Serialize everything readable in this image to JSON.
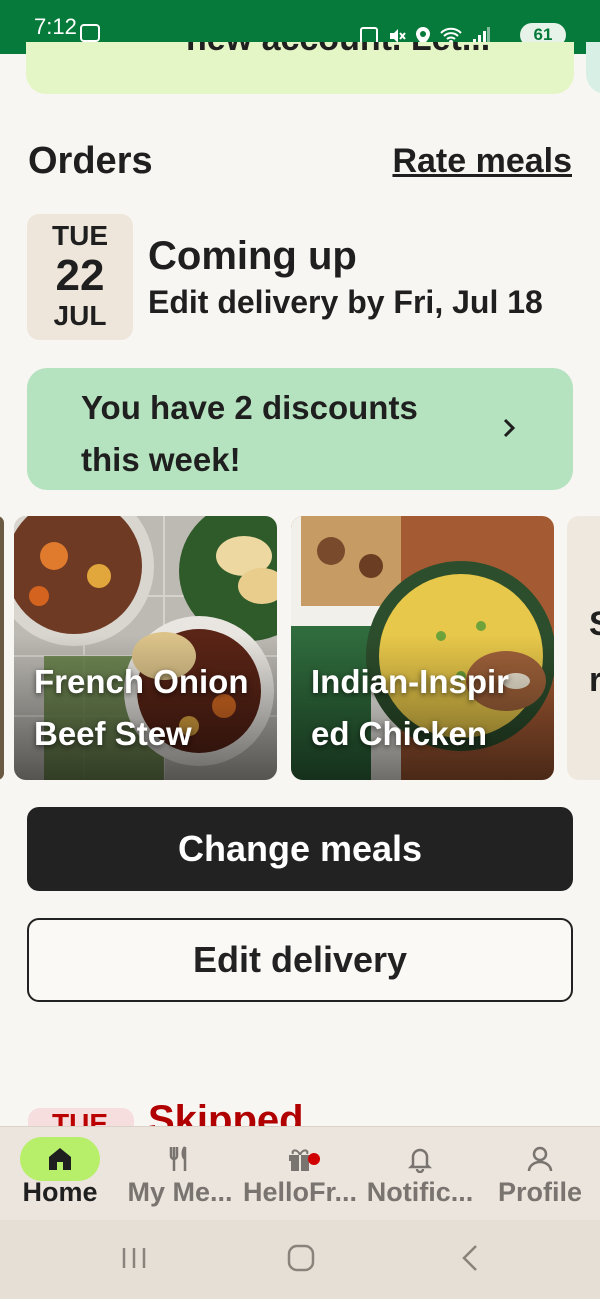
{
  "status_bar": {
    "time": "7:12",
    "battery": "61",
    "color": "#067a3a"
  },
  "promo_top": {
    "text": "new account. Let..."
  },
  "orders": {
    "title": "Orders",
    "rate_link": "Rate meals"
  },
  "delivery": {
    "day_of_week": "TUE",
    "day": "22",
    "month": "JUL",
    "title": "Coming up",
    "subtitle": "Edit delivery by Fri, Jul 18"
  },
  "discount_banner": {
    "text": "You have 2 discounts this week!",
    "icon": "chevron-right-icon",
    "color": "#b6e3bf"
  },
  "meals": [
    {
      "name": "French Onion Beef Stew"
    },
    {
      "name": "Indian-Inspired Chicken"
    },
    {
      "name": "S r"
    }
  ],
  "meal_card_labels": {
    "card1_line1": "French Onion",
    "card1_line2": "Beef Stew",
    "card2_line1": "Indian-Inspir",
    "card2_line2": "ed Chicken",
    "card3_line1": "S",
    "card3_line2": "r"
  },
  "buttons": {
    "change_meals": "Change meals",
    "edit_delivery": "Edit delivery"
  },
  "skipped": {
    "badge": "TUE",
    "title": "Skipped"
  },
  "bottom_nav": {
    "items": [
      {
        "label": "Home",
        "icon": "home-icon",
        "active": true
      },
      {
        "label": "My Me...",
        "icon": "fork-knife-icon",
        "active": false
      },
      {
        "label": "HelloFr...",
        "icon": "gift-icon",
        "active": false
      },
      {
        "label": "Notific...",
        "icon": "bell-icon",
        "active": false
      },
      {
        "label": "Profile",
        "icon": "person-icon",
        "active": false
      }
    ],
    "accent": "#b7ef6a"
  }
}
